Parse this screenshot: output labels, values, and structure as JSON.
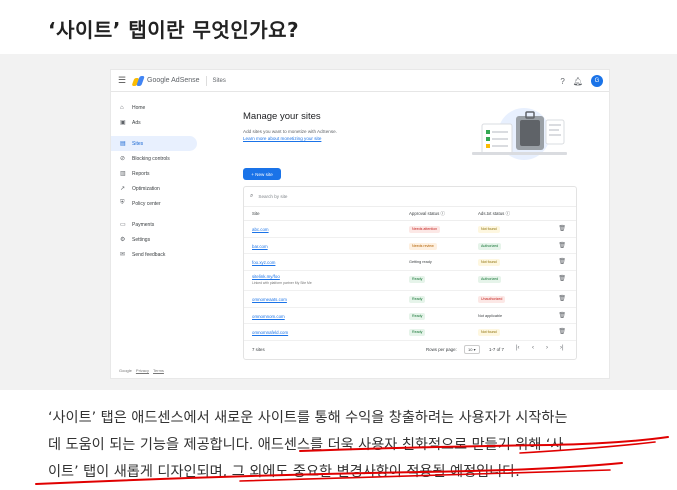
{
  "article": {
    "title": "‘사이트’ 탭이란 무엇인가요?",
    "body_lines": [
      "‘사이트’ 탭은 애드센스에서 새로운 사이트를 통해 수익을 창출하려는 사용자가 시작하는",
      "데 도움이 되는 기능을 제공합니다. 애드센스를 더욱 사용자 친화적으로 만들기 위해 ‘사",
      "이트’ 탭이 새롭게 디자인되며, 그 외에도 중요한 변경사항이 적용될 예정입니다."
    ],
    "highlight_color": "#e00000"
  },
  "adsense": {
    "brand": "Google AdSense",
    "breadcrumb": "Sites",
    "avatar": "G",
    "icons": {
      "menu": "menu-icon",
      "help": "help-icon",
      "notifications": "bell-icon"
    },
    "nav": [
      {
        "label": "Home",
        "icon": "⌂"
      },
      {
        "label": "Ads",
        "icon": "▣"
      },
      {
        "label": "Sites",
        "icon": "▤",
        "active": true
      },
      {
        "label": "Blocking controls",
        "icon": "⊘"
      },
      {
        "label": "Reports",
        "icon": "▥"
      },
      {
        "label": "Optimization",
        "icon": "↗"
      },
      {
        "label": "Policy center",
        "icon": "⛨"
      },
      {
        "label": "Payments",
        "icon": "▭"
      },
      {
        "label": "Settings",
        "icon": "⚙"
      },
      {
        "label": "Send feedback",
        "icon": "✉"
      }
    ],
    "footer_links": [
      "Google",
      "Privacy",
      "Terms"
    ],
    "main": {
      "title": "Manage your sites",
      "description": "Add sites you want to monetize with AdSense.",
      "learn_more": "Learn more about monetizing your site",
      "new_site_button": "+  New site",
      "search_placeholder": "Search by site",
      "columns": {
        "site": "Site",
        "approval": "Approval status ⓘ",
        "adstxt": "Ads.txt status ⓘ"
      },
      "rows": [
        {
          "site": "abc.com",
          "approval": "Needs attention",
          "approval_color": "red",
          "adstxt": "Not found",
          "adstxt_color": "yellow"
        },
        {
          "site": "bar.com",
          "approval": "Needs review",
          "approval_color": "orange",
          "adstxt": "Authorized",
          "adstxt_color": "green"
        },
        {
          "site": "foo.xyz.com",
          "approval": "Getting ready",
          "approval_color": "plain",
          "adstxt": "Not found",
          "adstxt_color": "yellow"
        },
        {
          "site": "sitelink.my/foo",
          "subtitle": "Linked with platform partner My Site Me",
          "approval": "Ready",
          "approval_color": "green",
          "adstxt": "Authorized",
          "adstxt_color": "green"
        },
        {
          "site": "omnomeaats.com",
          "approval": "Ready",
          "approval_color": "green",
          "adstxt": "Unauthorized",
          "adstxt_color": "red"
        },
        {
          "site": "omnomnom.com",
          "approval": "Ready",
          "approval_color": "green",
          "adstxt": "Not applicable",
          "adstxt_color": "plain"
        },
        {
          "site": "omnomnafeld.com",
          "approval": "Ready",
          "approval_color": "green",
          "adstxt": "Not found",
          "adstxt_color": "yellow"
        }
      ],
      "footer": {
        "count": "7 sites",
        "rows_per_page_label": "Rows per page:",
        "rows_per_page_value": "10",
        "range": "1-7 of 7"
      }
    }
  }
}
